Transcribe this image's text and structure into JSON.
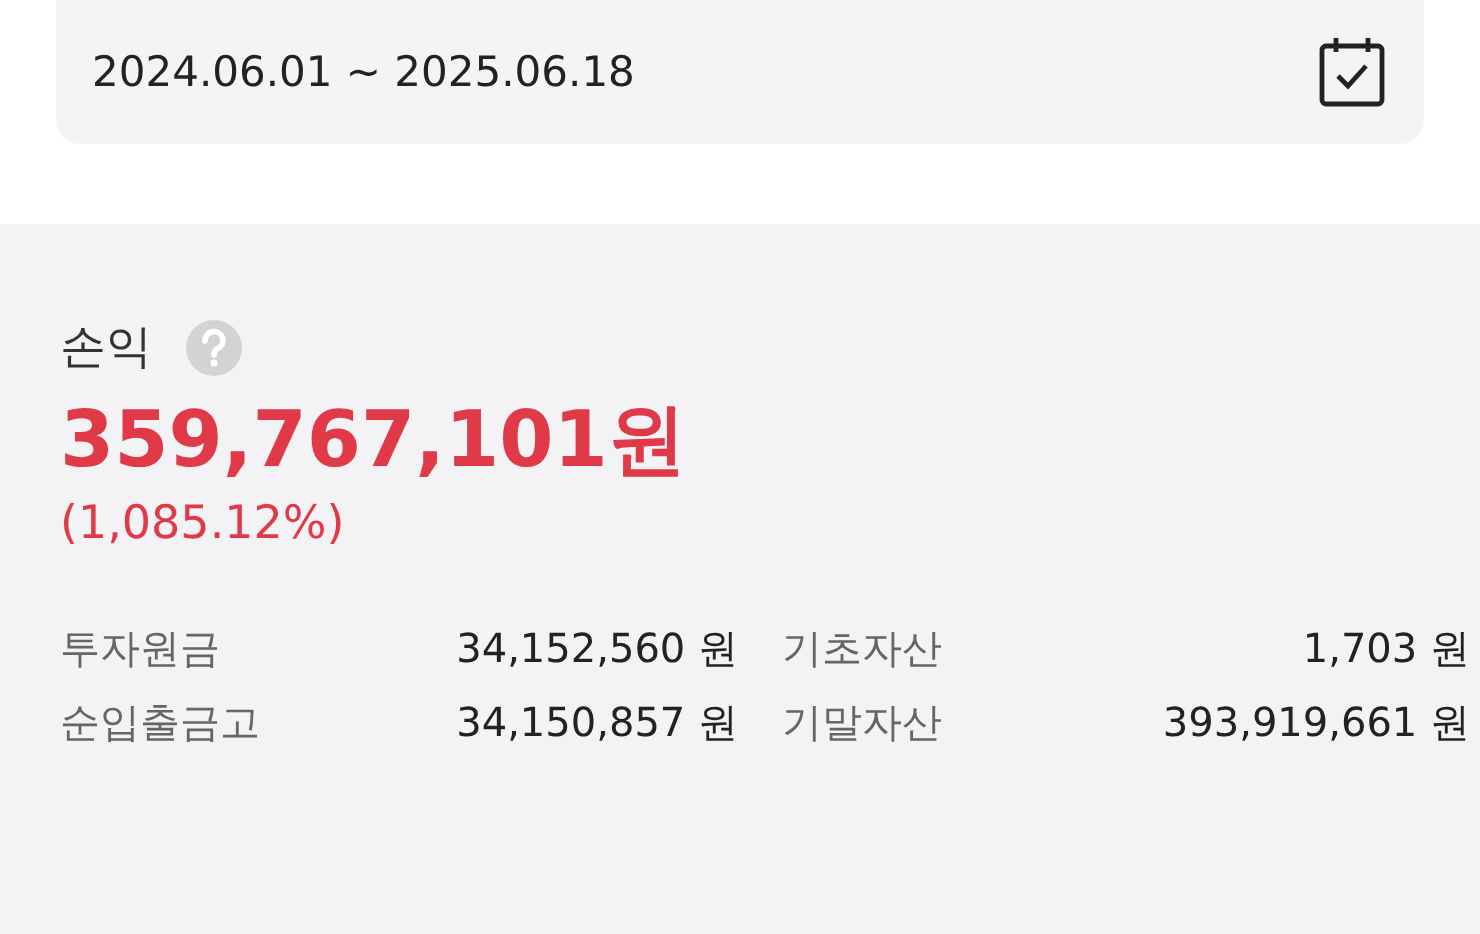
{
  "date_range": {
    "value": "2024.06.01 ~ 2025.06.18"
  },
  "profit": {
    "label": "손익",
    "amount": "359,767,101원",
    "rate": "(1,085.12%)"
  },
  "stats": [
    {
      "label": "투자원금",
      "value": "34,152,560 원"
    },
    {
      "label": "기초자산",
      "value": "1,703 원"
    },
    {
      "label": "순입출금고",
      "value": "34,150,857 원"
    },
    {
      "label": "기말자산",
      "value": "393,919,661 원"
    }
  ]
}
